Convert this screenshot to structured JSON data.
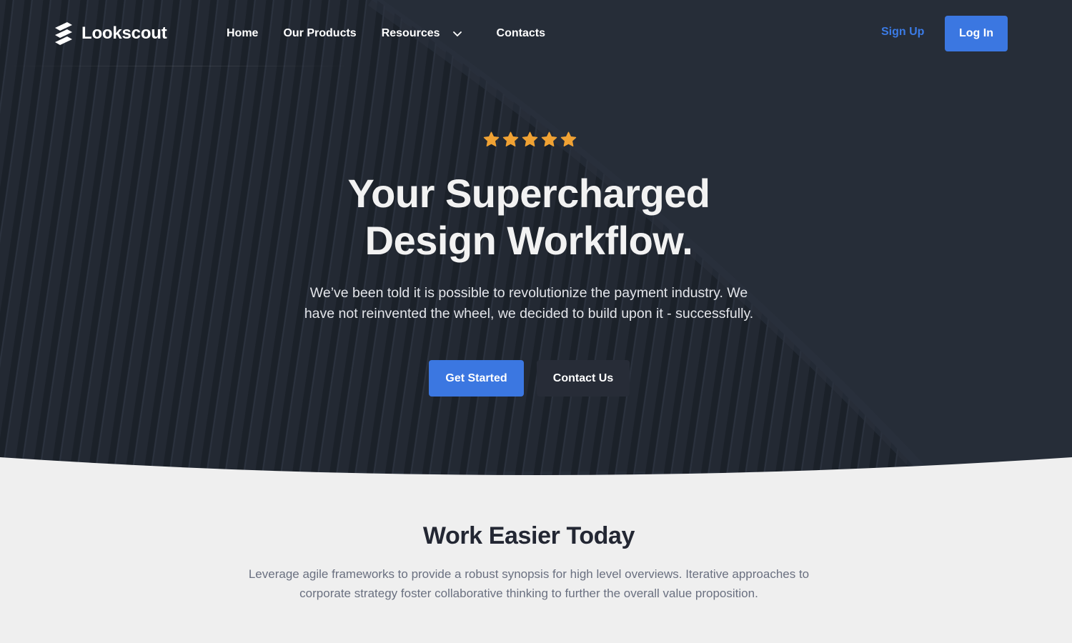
{
  "brand": {
    "name": "Lookscout",
    "logo_icon": "stacked-stripes-icon"
  },
  "nav": {
    "links": [
      {
        "label": "Home"
      },
      {
        "label": "Our Products"
      },
      {
        "label": "Resources",
        "icon": "chevron-down-icon"
      },
      {
        "label": "Contacts"
      }
    ],
    "signup_label": "Sign Up",
    "login_label": "Log In"
  },
  "hero": {
    "rating": {
      "stars": 5,
      "max": 5
    },
    "title_line1": "Your Supercharged",
    "title_line2": "Design Workflow.",
    "subtitle_line1": "We’ve been told it is possible to revolutionize the payment industry. We",
    "subtitle_line2": "have not reinvented the wheel, we decided to build upon it - successfully.",
    "primary_cta": "Get Started",
    "secondary_cta": "Contact Us"
  },
  "section": {
    "title": "Work Easier Today",
    "subtitle_line1": "Leverage agile frameworks to provide a robust synopsis for high level overviews. Iterative approaches to",
    "subtitle_line2": "corporate strategy foster collaborative thinking to further the overall value proposition."
  },
  "colors": {
    "hero_bg": "#2a303d",
    "accent": "#3b77e1",
    "star": "#f0a234",
    "page_bg": "#efefef",
    "heading_dark": "#232733",
    "muted_text": "#6a7080"
  }
}
